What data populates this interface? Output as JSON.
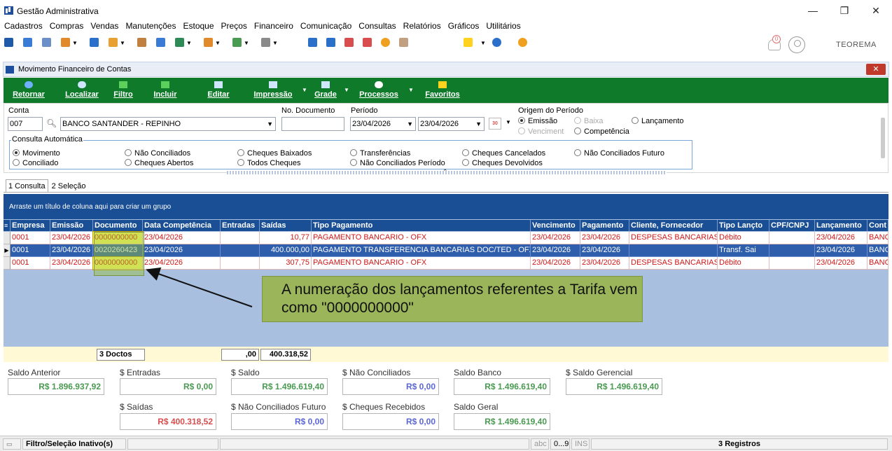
{
  "window": {
    "title": "Gestão Administrativa",
    "minimize": "—",
    "maximize": "❐",
    "close": "✕"
  },
  "menu": [
    "Cadastros",
    "Compras",
    "Vendas",
    "Manutenções",
    "Estoque",
    "Preços",
    "Financeiro",
    "Comunicação",
    "Consultas",
    "Relatórios",
    "Gráficos",
    "Utilitários"
  ],
  "header_right": {
    "notification_count": "0",
    "brand": "TEOREMA"
  },
  "child_window": {
    "title": "Movimento Financeiro de Contas",
    "close": "✕"
  },
  "actions": [
    {
      "label": "Retornar",
      "icon": "return-icon",
      "color": "#6fb0ff"
    },
    {
      "label": "Localizar",
      "icon": "search-icon",
      "color": "#cfe6ff"
    },
    {
      "label": "Filtro",
      "icon": "filter-icon",
      "color": "#5bd15b"
    },
    {
      "label": "Incluir",
      "icon": "plus-icon",
      "color": "#5bd15b"
    },
    {
      "label": "Editar",
      "icon": "edit-icon",
      "color": "#cfe6ff"
    },
    {
      "label": "Impressão",
      "icon": "printer-icon",
      "color": "#cfe6ff"
    },
    {
      "label": "Grade",
      "icon": "grid-icon",
      "color": "#cfe6ff"
    },
    {
      "label": "Processos",
      "icon": "gear-icon",
      "color": "#ffffff"
    },
    {
      "label": "Favoritos",
      "icon": "star-icon",
      "color": "#ffd21f"
    }
  ],
  "filter": {
    "conta_label": "Conta",
    "conta_code": "007",
    "conta_name": "BANCO SANTANDER - REPINHO",
    "documento_label": "No. Documento",
    "documento_value": "",
    "periodo_label": "Período",
    "periodo_start": "23/04/2026",
    "periodo_end": "23/04/2026",
    "calendar_day": "30",
    "origem_label": "Origem do Período",
    "origem_options": [
      {
        "label": "Emissão",
        "selected": true,
        "disabled": false
      },
      {
        "label": "Baixa",
        "selected": false,
        "disabled": true
      },
      {
        "label": "Lançamento",
        "selected": false,
        "disabled": false
      },
      {
        "label": "Venciment",
        "selected": false,
        "disabled": true
      },
      {
        "label": "Competência",
        "selected": false,
        "disabled": false
      }
    ],
    "consulta_label": "Consulta Automática",
    "consulta_options": [
      {
        "label": "Movimento",
        "selected": true
      },
      {
        "label": "Não Conciliados",
        "selected": false
      },
      {
        "label": "Cheques Baixados",
        "selected": false
      },
      {
        "label": "Transferências",
        "selected": false
      },
      {
        "label": "Cheques Cancelados",
        "selected": false
      },
      {
        "label": "Não Conciliados Futuro",
        "selected": false
      },
      {
        "label": "Conciliado",
        "selected": false
      },
      {
        "label": "Cheques Abertos",
        "selected": false
      },
      {
        "label": "Todos Cheques",
        "selected": false
      },
      {
        "label": "Não Conciliados Período",
        "selected": false
      },
      {
        "label": "Cheques Devolvidos",
        "selected": false
      }
    ]
  },
  "tabs": [
    {
      "label": "1 Consulta",
      "active": true
    },
    {
      "label": "2 Seleção",
      "active": false
    }
  ],
  "grid": {
    "group_hint": "Arraste um título de coluna aqui para criar um grupo",
    "columns": [
      "Empresa",
      "Emissão",
      "Documento",
      "Data Competência",
      "Entradas",
      "Saídas",
      "Tipo Pagamento",
      "Vencimento",
      "Pagamento",
      "Cliente, Fornecedor",
      "Tipo Lançto",
      "CPF/CNPJ",
      "Lançamento",
      "Cont"
    ],
    "rows": [
      [
        "0001",
        "23/04/2026",
        "0000000000",
        "23/04/2026",
        "",
        "10,77",
        "PAGAMENTO BANCARIO - OFX",
        "23/04/2026",
        "23/04/2026",
        "DESPESAS BANCARIAS",
        "Débito",
        "",
        "23/04/2026",
        "BANC"
      ],
      [
        "0001",
        "23/04/2026",
        "0020260423",
        "23/04/2026",
        "",
        "400.000,00",
        "PAGAMENTO TRANSFERENCIA BANCARIAS DOC/TED - OFX",
        "23/04/2026",
        "23/04/2026",
        "",
        "Transf. Sai",
        "",
        "23/04/2026",
        "BANC"
      ],
      [
        "0001",
        "23/04/2026",
        "0000000000",
        "23/04/2026",
        "",
        "307,75",
        "PAGAMENTO BANCARIO - OFX",
        "23/04/2026",
        "23/04/2026",
        "DESPESAS BANCARIAS",
        "Débito",
        "",
        "23/04/2026",
        "BANC"
      ]
    ],
    "selected_row": 1,
    "row_pointer": "▶"
  },
  "annotation": {
    "text": "A numeração dos lançamentos referentes a Tarifa vem como \"0000000000\""
  },
  "totals": {
    "count": "3 Doctos",
    "entradas": ",00",
    "saidas": "400.318,52"
  },
  "summary": {
    "saldo_anterior": {
      "label": "Saldo Anterior",
      "value": "R$ 1.896.937,92"
    },
    "entradas": {
      "label": "$ Entradas",
      "value": "R$ 0,00"
    },
    "saldo": {
      "label": "$ Saldo",
      "value": "R$ 1.496.619,40"
    },
    "nao_conciliados": {
      "label": "$ Não Conciliados",
      "value": "R$ 0,00"
    },
    "saldo_banco": {
      "label": "Saldo Banco",
      "value": "R$ 1.496.619,40"
    },
    "saldo_gerencial": {
      "label": "$ Saldo Gerencial",
      "value": "R$ 1.496.619,40"
    },
    "saidas": {
      "label": "$ Saídas",
      "value": "R$ 400.318,52"
    },
    "nao_conciliados_futuro": {
      "label": "$ Não Conciliados Futuro",
      "value": "R$ 0,00"
    },
    "cheques_recebidos": {
      "label": "$ Cheques Recebidos",
      "value": "R$ 0,00"
    },
    "saldo_geral": {
      "label": "Saldo Geral",
      "value": "R$ 1.496.619,40"
    }
  },
  "statusbar": {
    "filter_status": "Filtro/Seleção Inativo(s)",
    "abc": "abc",
    "digits": "0...9",
    "ins": "INS",
    "records": "3 Registros"
  }
}
